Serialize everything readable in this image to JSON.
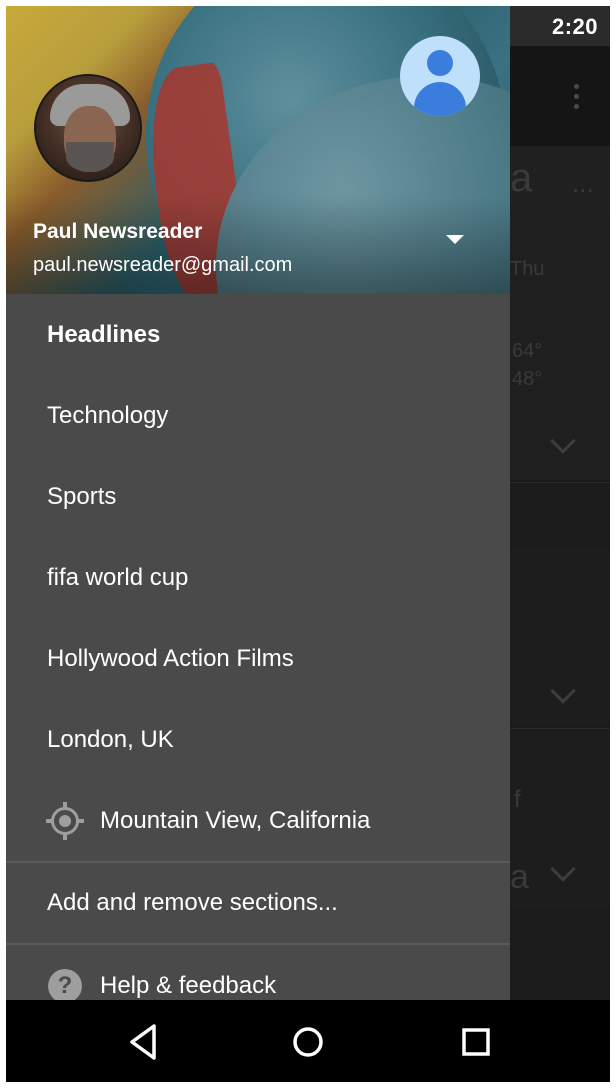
{
  "status_bar": {
    "time": "2:20"
  },
  "background_app": {
    "fragments": [
      {
        "text": "a"
      },
      {
        "text": "Thu"
      },
      {
        "text": "64°"
      },
      {
        "text": "48°"
      },
      {
        "text": "f"
      },
      {
        "text": "a"
      }
    ]
  },
  "drawer": {
    "account": {
      "name": "Paul Newsreader",
      "email": "paul.newsreader@gmail.com"
    },
    "items": [
      {
        "label": "Headlines"
      },
      {
        "label": "Technology"
      },
      {
        "label": "Sports"
      },
      {
        "label": "fifa world cup"
      },
      {
        "label": "Hollywood Action Films"
      },
      {
        "label": "London, UK"
      },
      {
        "label": "Mountain View, California",
        "icon": "location-target-icon"
      }
    ],
    "add_remove_label": "Add and remove sections...",
    "help_label": "Help & feedback",
    "help_icon_glyph": "?"
  },
  "nav_bar": {
    "back_icon": "back-triangle-icon",
    "home_icon": "home-circle-icon",
    "recents_icon": "recents-square-icon"
  },
  "colors": {
    "drawer_bg": "#4a4a4a",
    "navbar_bg": "#000000",
    "account_icon_bg": "#bfe0fb",
    "account_icon_fg": "#3b7ddd"
  }
}
